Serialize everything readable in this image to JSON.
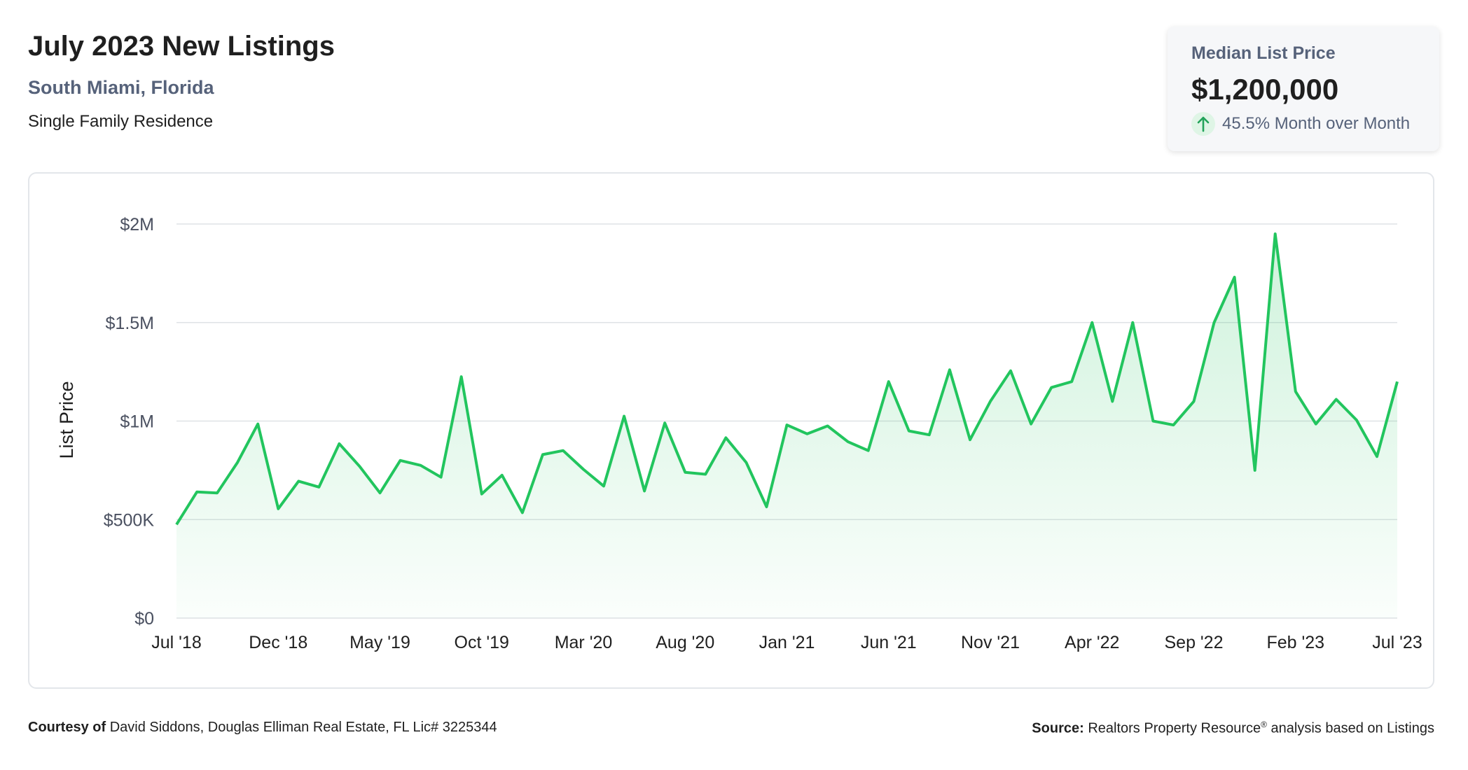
{
  "header": {
    "title": "July 2023 New Listings",
    "location": "South Miami, Florida",
    "property_type": "Single Family Residence"
  },
  "kpi": {
    "label": "Median List Price",
    "value": "$1,200,000",
    "change": "45.5% Month over Month",
    "direction_icon": "arrow-up-icon",
    "accent_color": "#22c55e"
  },
  "footer": {
    "courtesy_label": "Courtesy of",
    "courtesy_text": "David Siddons, Douglas Elliman Real Estate, FL Lic# 3225344",
    "source_label": "Source:",
    "source_text_1": "Realtors Property Resource",
    "source_sup": "®",
    "source_text_2": "analysis based on Listings"
  },
  "chart_data": {
    "type": "area",
    "ylabel": "List Price",
    "ylim": [
      0,
      2000000
    ],
    "yticks": [
      0,
      500000,
      1000000,
      1500000,
      2000000
    ],
    "ytick_labels": [
      "$0",
      "$500K",
      "$1M",
      "$1.5M",
      "$2M"
    ],
    "xtick_labels": [
      "Jul '18",
      "Dec '18",
      "May '19",
      "Oct '19",
      "Mar '20",
      "Aug '20",
      "Jan '21",
      "Jun '21",
      "Nov '21",
      "Apr '22",
      "Sep '22",
      "Feb '23",
      "Jul '23"
    ],
    "xtick_every_n_months": 5,
    "grid": true,
    "line_color": "#22c55e",
    "series": [
      {
        "start_month": "Jul '18",
        "values": [
          475000,
          640000,
          635000,
          790000,
          985000,
          555000,
          695000,
          665000,
          885000,
          770000,
          635000,
          800000,
          775000,
          715000,
          1225000,
          630000,
          725000,
          535000,
          830000,
          850000,
          755000,
          670000,
          1025000,
          645000,
          990000,
          740000,
          730000,
          915000,
          790000,
          565000,
          980000,
          935000,
          975000,
          895000,
          850000,
          1200000,
          950000,
          930000,
          1260000,
          905000,
          1100000,
          1255000,
          985000,
          1170000,
          1200000,
          1500000,
          1100000,
          1500000,
          1000000,
          980000,
          1100000,
          1500000,
          1730000,
          750000,
          1950000,
          1150000,
          985000,
          1110000,
          1005000,
          820000,
          1200000
        ]
      }
    ]
  }
}
